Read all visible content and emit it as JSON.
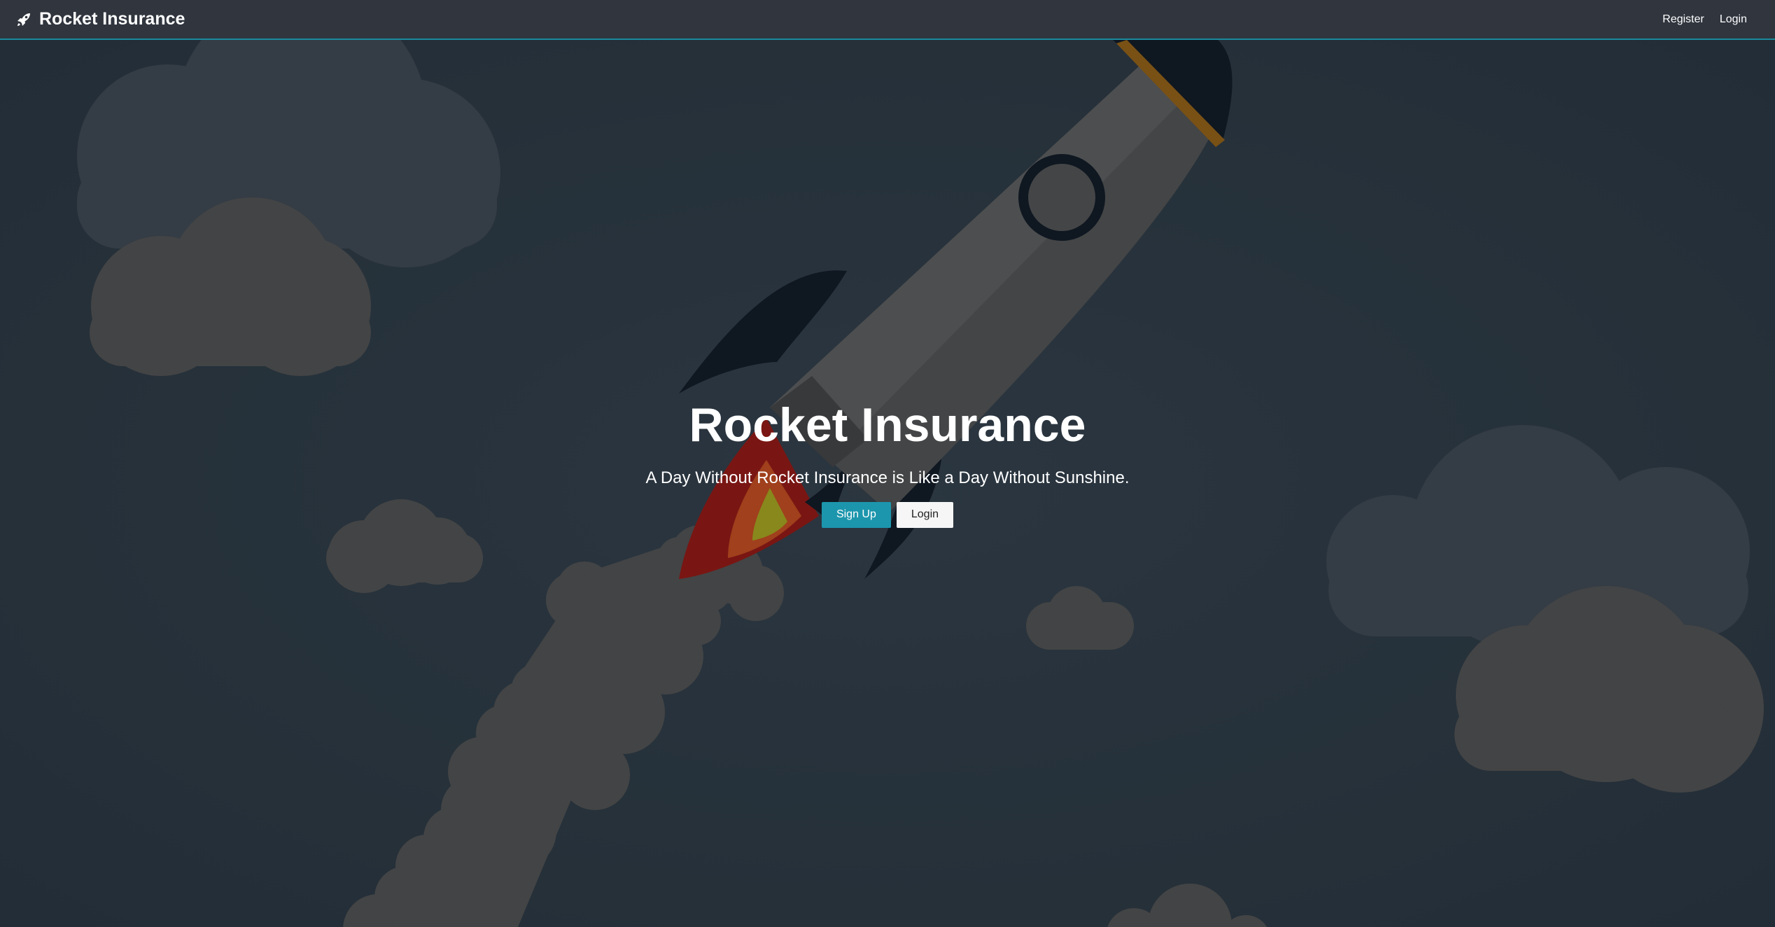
{
  "nav": {
    "brand": "Rocket Insurance",
    "links": [
      "Register",
      "Login"
    ]
  },
  "hero": {
    "title": "Rocket Insurance",
    "tagline": "A Day Without Rocket Insurance is Like a Day Without Sunshine.",
    "signup_label": "Sign Up",
    "login_label": "Login"
  },
  "icons": {
    "brand": "rocket-icon"
  },
  "colors": {
    "navbar_bg": "#30353e",
    "accent": "#1c96ad",
    "background": "#2b3640",
    "cloud": "#4a4a4a"
  }
}
